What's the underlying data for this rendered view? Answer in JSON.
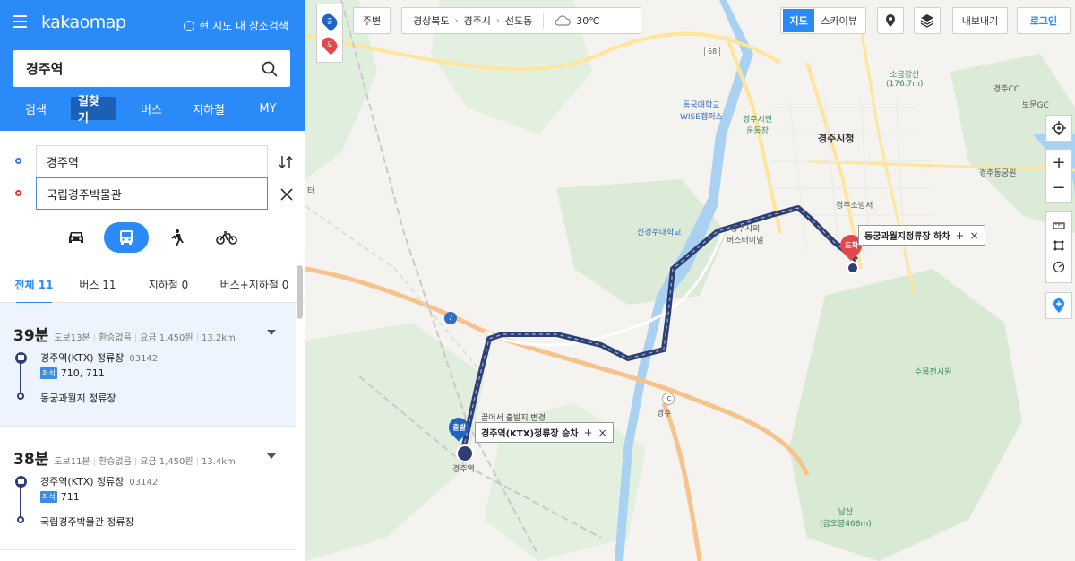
{
  "header": {
    "logo": "kakaomap",
    "area_search_label": "현 지도 내 장소검색",
    "search_value": "경주역"
  },
  "nav_tabs": [
    "검색",
    "길찾기",
    "버스",
    "지하철",
    "MY"
  ],
  "route": {
    "origin": "경주역",
    "destination": "국립경주박물관"
  },
  "modes": [
    "car",
    "bus",
    "walk",
    "bike"
  ],
  "result_tabs": [
    "전체 11",
    "버스 11",
    "지하철 0",
    "버스+지하철 0"
  ],
  "results": [
    {
      "duration": "39분",
      "walk": "도보13분",
      "transfer": "환승없음",
      "fare": "요금 1,450원",
      "distance": "13.2km",
      "board_stop": "경주역(KTX) 정류장",
      "board_code": "03142",
      "bus_tag": "좌석",
      "bus_numbers": "710, 711",
      "alight_stop": "동궁과월지 정류장"
    },
    {
      "duration": "38분",
      "walk": "도보11분",
      "transfer": "환승없음",
      "fare": "요금 1,450원",
      "distance": "13.4km",
      "board_stop": "경주역(KTX) 정류장",
      "board_code": "03142",
      "bus_tag": "좌석",
      "bus_numbers": "711",
      "alight_stop": "국립경주박물관 정류장"
    }
  ],
  "map": {
    "side_markers": [
      "출",
      "도"
    ],
    "nearby_button": "주변",
    "breadcrumb": [
      "경상북도",
      "경주시",
      "선도동"
    ],
    "weather": "30℃",
    "view_toggle": [
      "지도",
      "스카이뷰"
    ],
    "export_button": "내보내기",
    "login_button": "로그인",
    "start_marker": "출발",
    "end_marker": "도착",
    "start_label": "경주역(KTX)정류장 승차",
    "end_label": "동궁과월지정류장 하차",
    "hidden_label": "끌어서 출발지 변경",
    "places": {
      "dongguk": "동국대학교\nWISE캠퍼스",
      "city_hall": "경주시청",
      "fire": "경주소방서",
      "sinkyungju": "신경주대학교",
      "terminal": "경주시외\n버스터미널",
      "gyeongju_ic": "경주",
      "sogeum": "소금강산\n(176.7m)",
      "cc": "경주CC",
      "bomun": "보문GC",
      "dongbu": "경주동궁원",
      "sukjeon": "수목전시원",
      "namsan": "남산\n(금오봉468m)",
      "gyeongju_station": "경주역",
      "siminundong": "경주시민\n운동장",
      "route_7": "7",
      "route_68": "68",
      "ic_label": "IC",
      "ter": "터"
    }
  },
  "colors": {
    "brand": "#2a8af7",
    "route": "#2e3f73",
    "start": "#1e63c5",
    "end": "#e4474b"
  }
}
